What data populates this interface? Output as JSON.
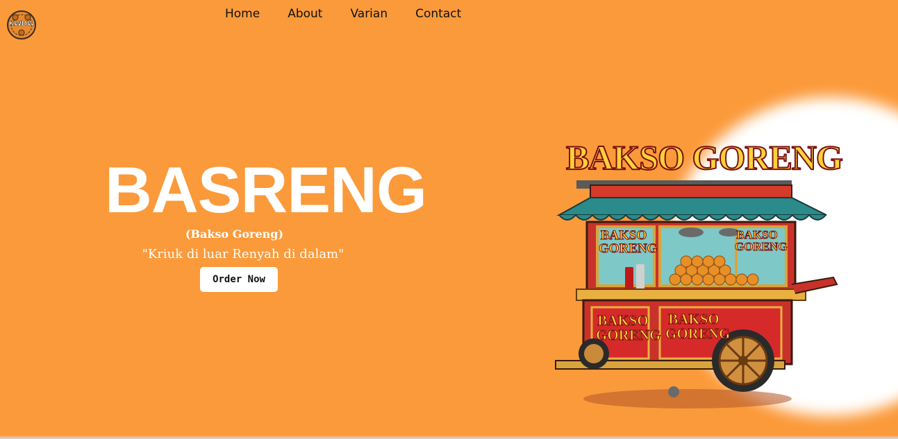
{
  "logo": {
    "text": "KWDW"
  },
  "nav": {
    "home": "Home",
    "about": "About",
    "varian": "Varian",
    "contact": "Contact"
  },
  "hero": {
    "title": "BASRENG",
    "subtitle": "(Bakso Goreng)",
    "tagline": "\"Kriuk di luar Renyah di dalam\"",
    "cta_label": "Order Now"
  },
  "illustration": {
    "sign_text": "BAKSO GORENG",
    "panel_text": "BAKSO GORENG"
  },
  "colors": {
    "background": "#fb9a3a",
    "text_primary": "#ffffff",
    "nav_text": "#111111",
    "button_bg": "#ffffff"
  }
}
